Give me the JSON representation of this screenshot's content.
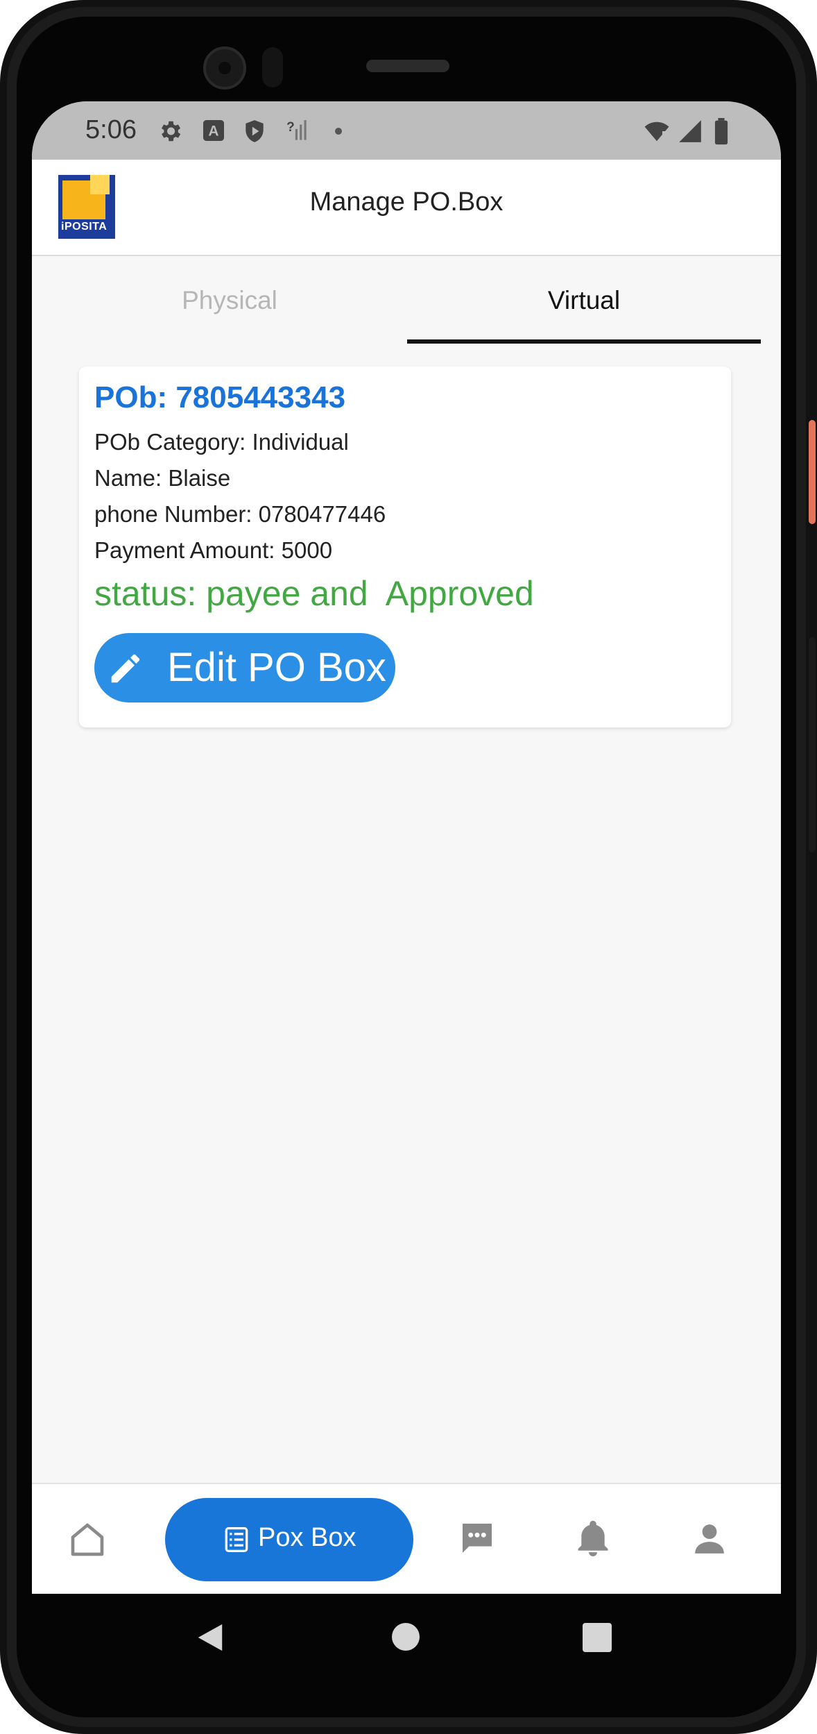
{
  "status_bar": {
    "time": "5:06"
  },
  "app_bar": {
    "title": "Manage PO.Box",
    "logo_text": "iPOSITA"
  },
  "tabs": [
    {
      "label": "Physical",
      "selected": false
    },
    {
      "label": "Virtual",
      "selected": true
    }
  ],
  "card": {
    "pob_number": "POb: 7805443343",
    "category": "POb Category: Individual",
    "name": "Name: Blaise",
    "phone": "phone Number: 0780477446",
    "payment": "Payment Amount: 5000",
    "status": "status: payee and  Approved",
    "edit_button": "Edit PO Box"
  },
  "bottom_nav": {
    "items": [
      {
        "icon": "home-icon"
      },
      {
        "icon": "list-icon",
        "label": "Pox Box",
        "active": true
      },
      {
        "icon": "chat-icon"
      },
      {
        "icon": "bell-icon"
      },
      {
        "icon": "person-icon"
      }
    ]
  },
  "colors": {
    "accent_blue": "#1976d9",
    "status_green": "#43a843",
    "pob_blue": "#1a73d9"
  }
}
